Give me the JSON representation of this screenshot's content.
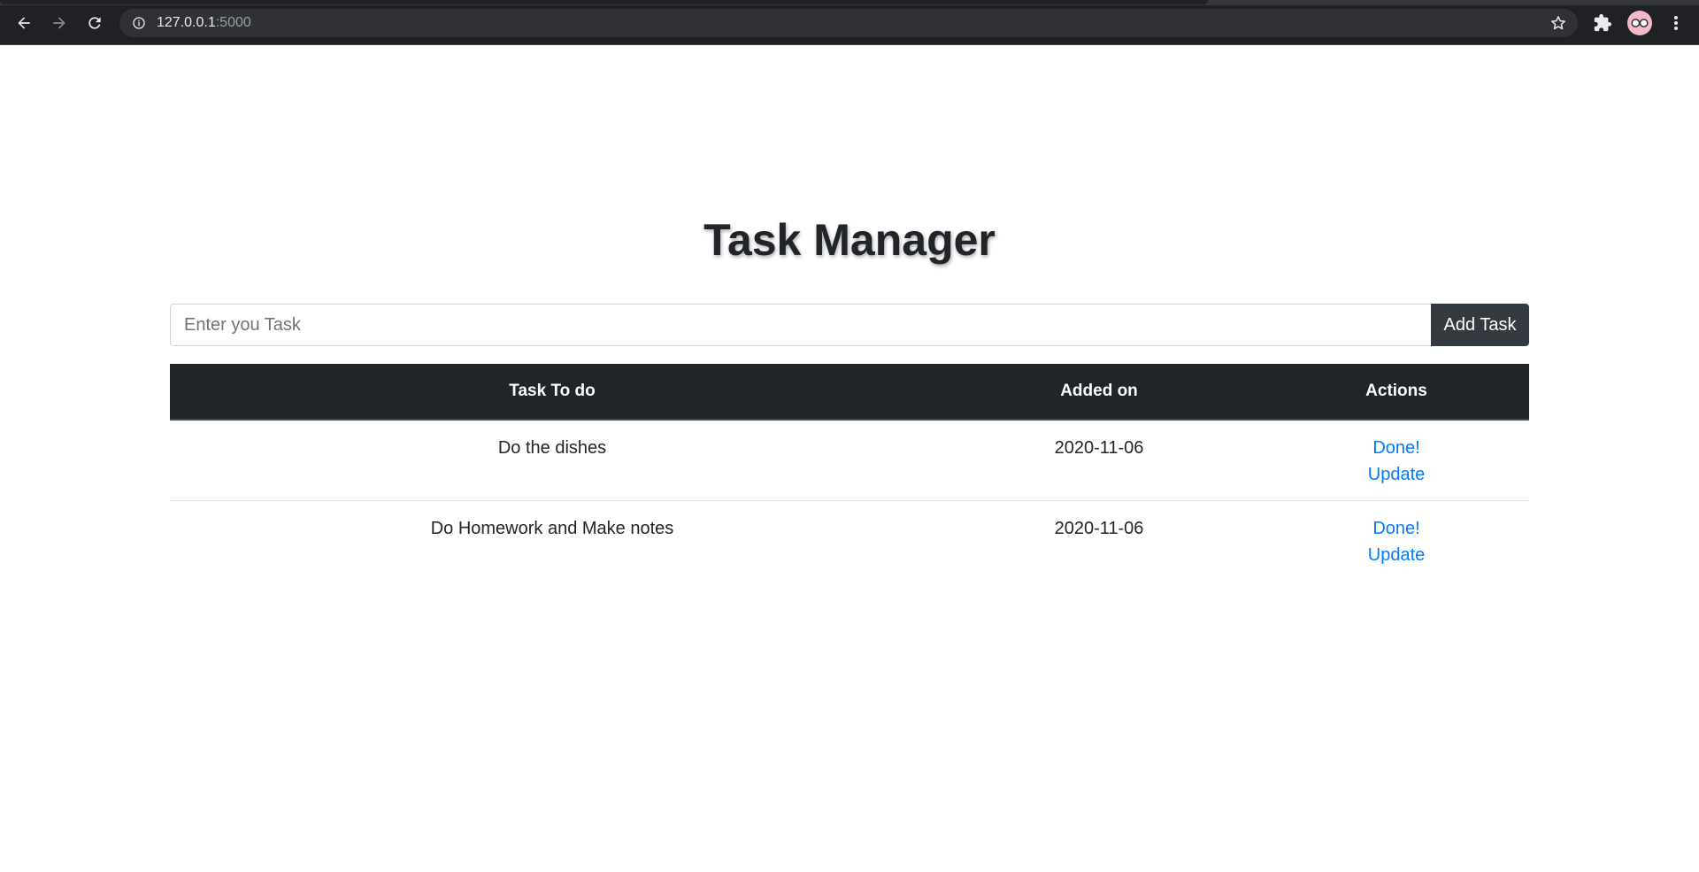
{
  "browser": {
    "url_host": "127.0.0.1",
    "url_port": ":5000"
  },
  "page": {
    "title": "Task Manager"
  },
  "form": {
    "placeholder": "Enter you Task",
    "add_button_label": "Add Task"
  },
  "table": {
    "headers": [
      "Task To do",
      "Added on",
      "Actions"
    ],
    "rows": [
      {
        "task": "Do the dishes",
        "added_on": "2020-11-06",
        "done_label": "Done!",
        "update_label": "Update"
      },
      {
        "task": "Do Homework and Make notes",
        "added_on": "2020-11-06",
        "done_label": "Done!",
        "update_label": "Update"
      }
    ]
  },
  "colors": {
    "header_bg": "#212529",
    "link": "#007bff",
    "button_bg": "#343a40"
  }
}
